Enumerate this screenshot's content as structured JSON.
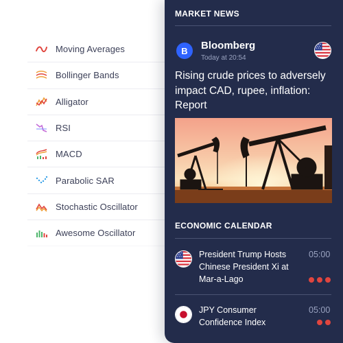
{
  "indicators": [
    {
      "label": "Moving Averages",
      "icon": "moving-averages-icon"
    },
    {
      "label": "Bollinger Bands",
      "icon": "bollinger-bands-icon"
    },
    {
      "label": "Alligator",
      "icon": "alligator-icon"
    },
    {
      "label": "RSI",
      "icon": "rsi-icon"
    },
    {
      "label": "MACD",
      "icon": "macd-icon"
    },
    {
      "label": "Parabolic SAR",
      "icon": "parabolic-sar-icon"
    },
    {
      "label": "Stochastic Oscillator",
      "icon": "stochastic-oscillator-icon"
    },
    {
      "label": "Awesome Oscillator",
      "icon": "awesome-oscillator-icon"
    }
  ],
  "market_news": {
    "title": "MARKET NEWS",
    "source": {
      "name": "Bloomberg",
      "logo_letter": "B",
      "time": "Today at 20:54",
      "flag": "us-flag-icon"
    },
    "headline": "Rising crude prices to adversely impact CAD, rupee, inflation: Report",
    "image": "oil-pumpjacks-sunset-image"
  },
  "economic_calendar": {
    "title": "ECONOMIC CALENDAR",
    "events": [
      {
        "title": "President Trump Hosts Chinese President Xi at Mar-a-Lago",
        "time": "05:00",
        "flag": "us-flag-icon",
        "impact": 3
      },
      {
        "title": "JPY Consumer Confidence Index",
        "time": "05:00",
        "flag": "japan-flag-icon",
        "impact": 2
      }
    ]
  },
  "colors": {
    "panel_bg": "#232c4b",
    "accent_blue": "#2f63ff",
    "impact_red": "#e0453e",
    "muted_text": "#9aa3c0",
    "indicator_text": "#3b3f57"
  }
}
